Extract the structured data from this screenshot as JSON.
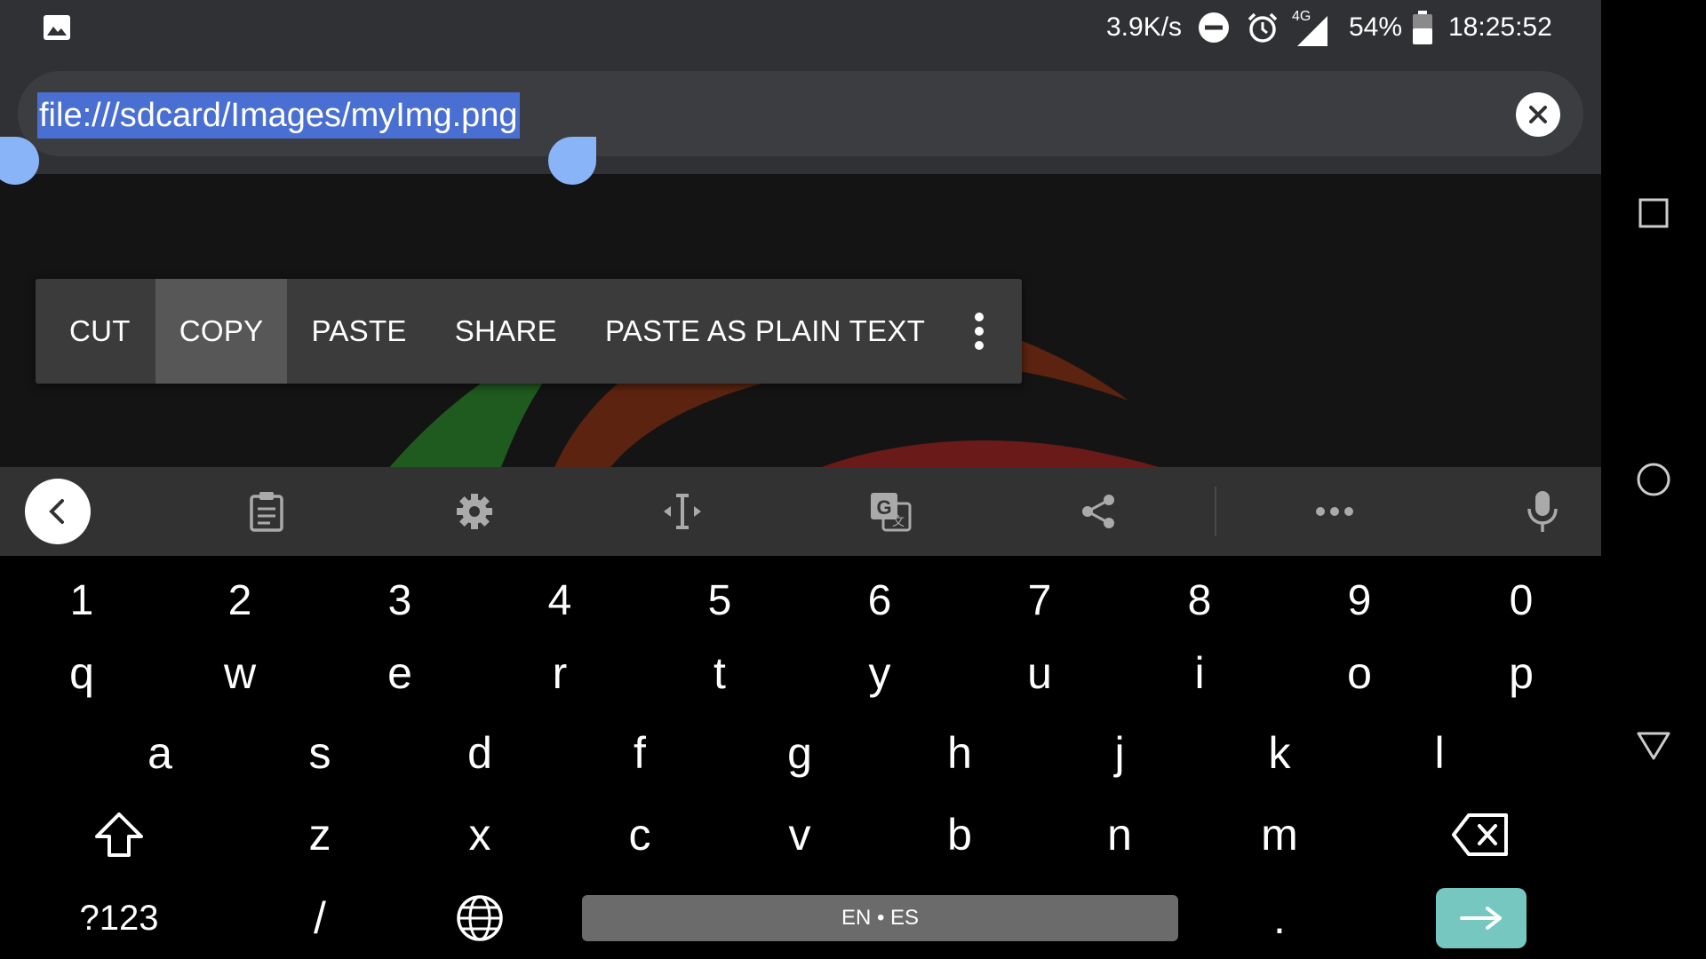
{
  "status_bar": {
    "net_speed": "3.9K/s",
    "network_type": "4G",
    "battery": "54%",
    "time": "18:25:52",
    "icons": [
      "gallery-icon",
      "dnd-icon",
      "alarm-icon",
      "signal-icon",
      "battery-icon"
    ]
  },
  "url_bar": {
    "value": "file:///sdcard/Images/myImg.png",
    "clear_icon": "close-circle-icon"
  },
  "context_menu": {
    "items": [
      {
        "label": "CUT"
      },
      {
        "label": "COPY"
      },
      {
        "label": "PASTE"
      },
      {
        "label": "SHARE"
      },
      {
        "label": "PASTE AS PLAIN TEXT"
      }
    ],
    "overflow_icon": "more-vert-icon"
  },
  "keyboard_toolbar": {
    "icons": [
      "back-chevron-icon",
      "clipboard-icon",
      "settings-gear-icon",
      "text-cursor-icon",
      "translate-icon",
      "share-icon",
      "more-horiz-icon",
      "microphone-icon"
    ]
  },
  "keyboard": {
    "number_row": [
      "1",
      "2",
      "3",
      "4",
      "5",
      "6",
      "7",
      "8",
      "9",
      "0"
    ],
    "row1": [
      "q",
      "w",
      "e",
      "r",
      "t",
      "y",
      "u",
      "i",
      "o",
      "p"
    ],
    "row2": [
      "a",
      "s",
      "d",
      "f",
      "g",
      "h",
      "j",
      "k",
      "l"
    ],
    "row3": [
      "z",
      "x",
      "c",
      "v",
      "b",
      "n",
      "m"
    ],
    "symbols_label": "?123",
    "slash_label": "/",
    "space_label": "EN • ES",
    "period_label": ".",
    "icons": [
      "shift-icon",
      "backspace-icon",
      "globe-icon",
      "enter-arrow-icon"
    ],
    "accent_color": "#76c7c0"
  },
  "nav_bar": {
    "icons": [
      "recents-square-icon",
      "home-circle-icon",
      "back-triangle-icon"
    ]
  }
}
